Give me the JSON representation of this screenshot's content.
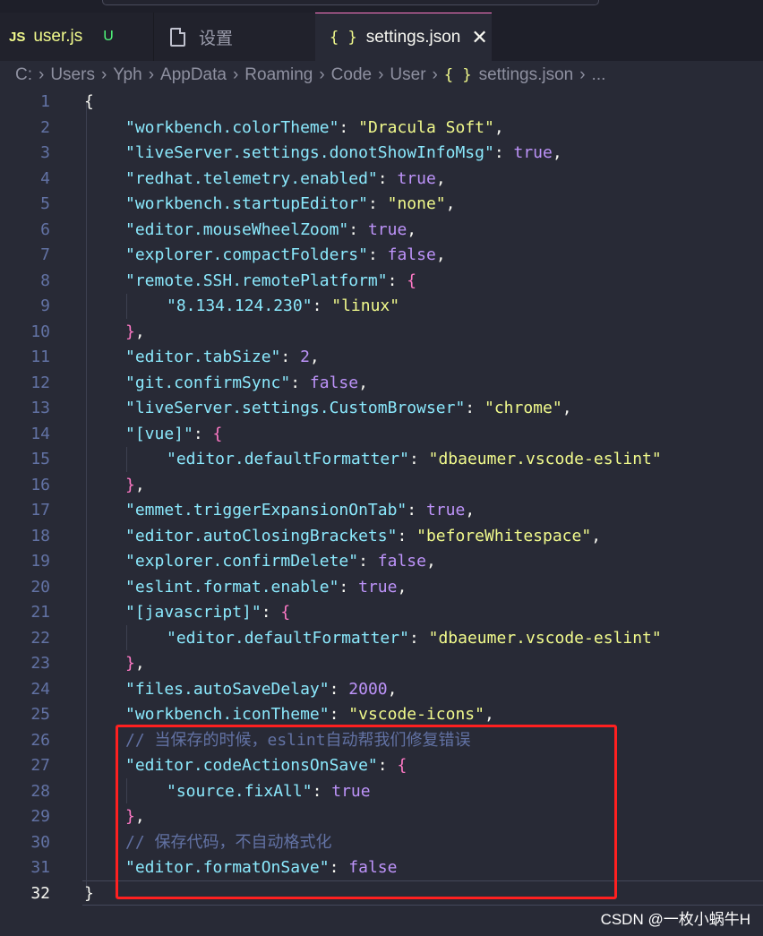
{
  "tabs": [
    {
      "icon": "JS",
      "label": "user.js",
      "badge": "U"
    },
    {
      "label": "设置"
    },
    {
      "icon": "{ }",
      "label": "settings.json",
      "close": "✕"
    }
  ],
  "breadcrumb": [
    "C:",
    "Users",
    "Yph",
    "AppData",
    "Roaming",
    "Code",
    "User",
    "settings.json",
    "..."
  ],
  "breadcrumb_file_icon": "{ }",
  "code_lines": [
    {
      "num": "1",
      "text": "{"
    },
    {
      "num": "2",
      "text": "\"workbench.colorTheme\": \"Dracula Soft\","
    },
    {
      "num": "3",
      "text": "\"liveServer.settings.donotShowInfoMsg\": true,"
    },
    {
      "num": "4",
      "text": "\"redhat.telemetry.enabled\": true,"
    },
    {
      "num": "5",
      "text": "\"workbench.startupEditor\": \"none\","
    },
    {
      "num": "6",
      "text": "\"editor.mouseWheelZoom\": true,"
    },
    {
      "num": "7",
      "text": "\"explorer.compactFolders\": false,"
    },
    {
      "num": "8",
      "text": "\"remote.SSH.remotePlatform\": {"
    },
    {
      "num": "9",
      "text": "\"8.134.124.230\": \"linux\""
    },
    {
      "num": "10",
      "text": "},"
    },
    {
      "num": "11",
      "text": "\"editor.tabSize\": 2,"
    },
    {
      "num": "12",
      "text": "\"git.confirmSync\": false,"
    },
    {
      "num": "13",
      "text": "\"liveServer.settings.CustomBrowser\": \"chrome\","
    },
    {
      "num": "14",
      "text": "\"[vue]\": {"
    },
    {
      "num": "15",
      "text": "\"editor.defaultFormatter\": \"dbaeumer.vscode-eslint\""
    },
    {
      "num": "16",
      "text": "},"
    },
    {
      "num": "17",
      "text": "\"emmet.triggerExpansionOnTab\": true,"
    },
    {
      "num": "18",
      "text": "\"editor.autoClosingBrackets\": \"beforeWhitespace\","
    },
    {
      "num": "19",
      "text": "\"explorer.confirmDelete\": false,"
    },
    {
      "num": "20",
      "text": "\"eslint.format.enable\": true,"
    },
    {
      "num": "21",
      "text": "\"[javascript]\": {"
    },
    {
      "num": "22",
      "text": "\"editor.defaultFormatter\": \"dbaeumer.vscode-eslint\""
    },
    {
      "num": "23",
      "text": "},"
    },
    {
      "num": "24",
      "text": "\"files.autoSaveDelay\": 2000,"
    },
    {
      "num": "25",
      "text": "\"workbench.iconTheme\": \"vscode-icons\","
    },
    {
      "num": "26",
      "text": "// 当保存的时候，eslint自动帮我们修复错误"
    },
    {
      "num": "27",
      "text": "\"editor.codeActionsOnSave\": {"
    },
    {
      "num": "28",
      "text": "\"source.fixAll\": true"
    },
    {
      "num": "29",
      "text": "},"
    },
    {
      "num": "30",
      "text": "// 保存代码，不自动格式化"
    },
    {
      "num": "31",
      "text": "\"editor.formatOnSave\": false"
    },
    {
      "num": "32",
      "text": "}"
    }
  ],
  "watermark": "CSDN @一枚小蜗牛H",
  "colors": {
    "background": "#282a36",
    "key": "#8be9fd",
    "string": "#f1fa8c",
    "boolean_number": "#bd93f9",
    "bracket": "#ff79c6",
    "comment": "#6272a4",
    "highlight_box": "#ff2020"
  }
}
